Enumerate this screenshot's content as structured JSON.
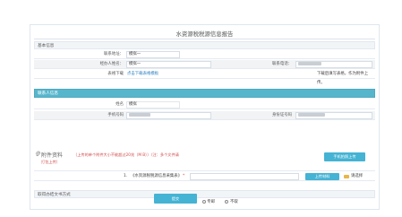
{
  "page_title": "水资源税税源信息报告",
  "basic_info": {
    "section_label": "基本信息",
    "contact_address_label": "联系地址：",
    "contact_address_value": "模拟一",
    "operator_name_label": "经办人姓名：",
    "operator_name_value": "模拟一",
    "contact_phone_label": "联系电话：",
    "form_download_label": "表格下载",
    "form_download_link": "点击下载表格模板",
    "form_download_hint": "下载后填写表格，作为附件上传。"
  },
  "contact_person": {
    "section_label": "联系人信息",
    "name_label": "姓名",
    "name_value": "模拟",
    "mobile_label": "手机号码",
    "id_label": "身份证号码"
  },
  "attachments": {
    "title": "附件资料",
    "note_line1": "（上传的单个附件大小不能超过20兆（M B））（注：多个文件请",
    "note_line2": "打包上传）",
    "mobile_upload_button": "手机拍照上传",
    "doc_index": "1.",
    "doc_name": "《水资源税税源信息采集表》",
    "doc_required_mark": "*",
    "upload_material_button": "上传材料",
    "select_label": "请选择"
  },
  "pickup": {
    "section_label": "取得办结文书方式",
    "options": [
      "上门自取",
      "专邮",
      "不取"
    ]
  },
  "submit_button": "提交",
  "colors": {
    "accent": "#44b3d4",
    "teal_header": "#58b6cc",
    "warning": "#d24a4a",
    "link": "#2a7fc1"
  }
}
